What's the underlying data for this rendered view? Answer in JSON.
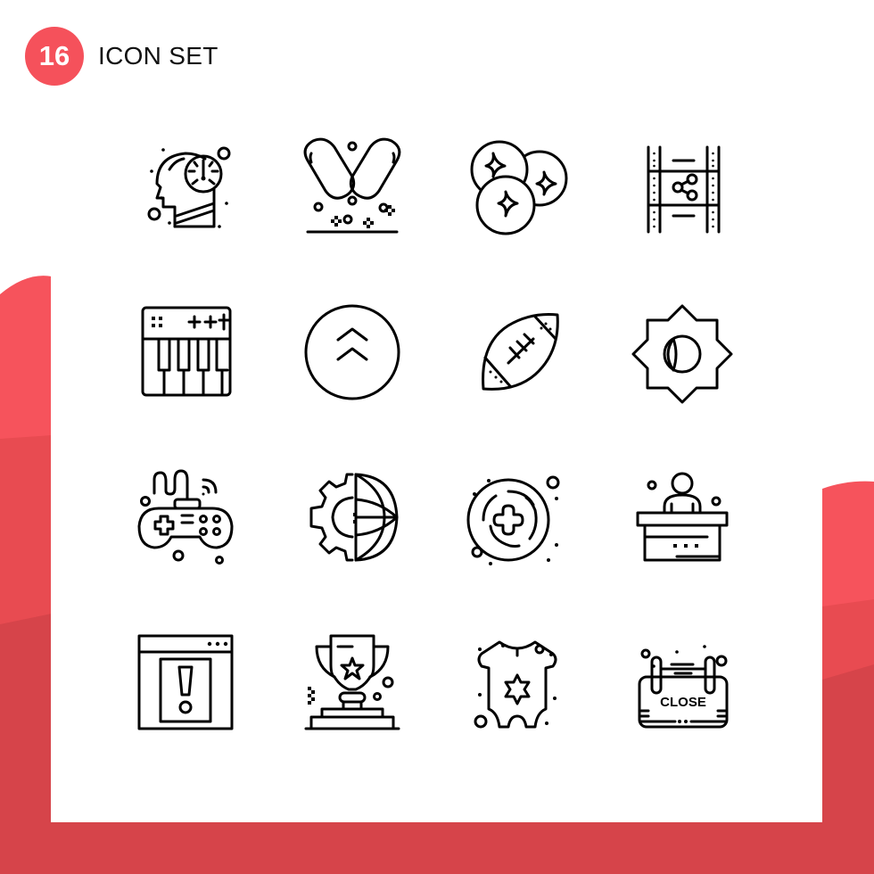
{
  "header": {
    "badge_number": "16",
    "title": "ICON SET"
  },
  "colors": {
    "accent": "#f5515b",
    "band_light": "#f6535c",
    "band_mid": "#e84b51",
    "band_dark": "#d6444a",
    "icon_stroke": "#000000",
    "card": "#ffffff"
  },
  "icons": [
    {
      "name": "mind-speedometer-icon",
      "label": "head with gauge"
    },
    {
      "name": "capsules-icon",
      "label": "pills"
    },
    {
      "name": "coins-icon",
      "label": "sparkle coins"
    },
    {
      "name": "film-share-icon",
      "label": "film strip share"
    },
    {
      "name": "piano-keyboard-icon",
      "label": "synth keyboard"
    },
    {
      "name": "double-chevron-up-icon",
      "label": "scroll up"
    },
    {
      "name": "american-football-icon",
      "label": "rugby ball"
    },
    {
      "name": "islamic-star-moon-icon",
      "label": "eight point star moon"
    },
    {
      "name": "gamepad-icon",
      "label": "wireless game controller"
    },
    {
      "name": "gear-globe-icon",
      "label": "settings world"
    },
    {
      "name": "add-button-icon",
      "label": "plus in circles"
    },
    {
      "name": "reception-desk-icon",
      "label": "person at desk"
    },
    {
      "name": "browser-alert-icon",
      "label": "window exclamation"
    },
    {
      "name": "trophy-icon",
      "label": "star trophy"
    },
    {
      "name": "baby-onesie-icon",
      "label": "baby clothes"
    },
    {
      "name": "close-sign-icon",
      "label": "hanging close sign"
    }
  ],
  "close_sign_text": "CLOSE"
}
